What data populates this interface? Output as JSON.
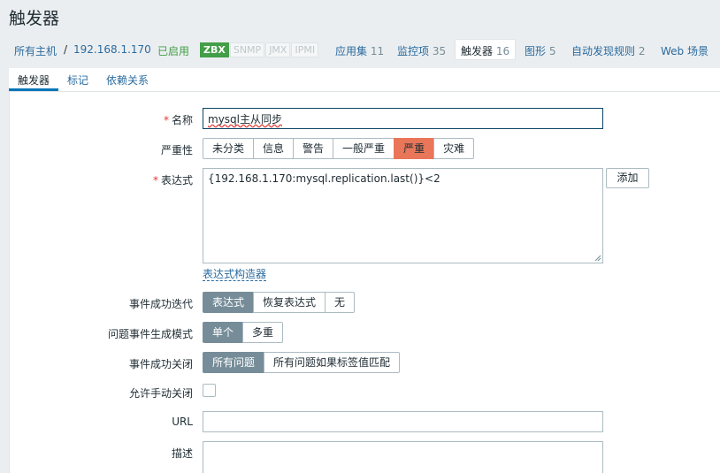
{
  "page": {
    "title": "触发器"
  },
  "host_nav": {
    "all_hosts": "所有主机",
    "separator": "/",
    "host": "192.168.1.170",
    "status": "已启用",
    "interfaces": [
      "ZBX",
      "SNMP",
      "JMX",
      "IPMI"
    ],
    "applications": {
      "label": "应用集",
      "count": "11"
    },
    "items": {
      "label": "监控项",
      "count": "35"
    },
    "triggers": {
      "label": "触发器",
      "count": "16"
    },
    "graphs": {
      "label": "图形",
      "count": "5"
    },
    "discovery": {
      "label": "自动发现规则",
      "count": "2"
    },
    "web": {
      "label": "Web 场景"
    }
  },
  "tabs": [
    "触发器",
    "标记",
    "依赖关系"
  ],
  "form": {
    "name": {
      "label": "名称",
      "value": "mysql主从同步"
    },
    "severity": {
      "label": "严重性",
      "options": [
        "未分类",
        "信息",
        "警告",
        "一般严重",
        "严重",
        "灾难"
      ],
      "selected": "严重"
    },
    "expression": {
      "label": "表达式",
      "value": "{192.168.1.170:mysql.replication.last()}<2",
      "add_button": "添加",
      "builder_link": "表达式构造器"
    },
    "ok_event_generation": {
      "label": "事件成功迭代",
      "options": [
        "表达式",
        "恢复表达式",
        "无"
      ],
      "selected": "表达式"
    },
    "problem_event_mode": {
      "label": "问题事件生成模式",
      "options": [
        "单个",
        "多重"
      ],
      "selected": "单个"
    },
    "ok_event_closes": {
      "label": "事件成功关闭",
      "options": [
        "所有问题",
        "所有问题如果标签值匹配"
      ],
      "selected": "所有问题"
    },
    "manual_close": {
      "label": "允许手动关闭",
      "checked": false
    },
    "url": {
      "label": "URL",
      "value": ""
    },
    "description": {
      "label": "描述",
      "value": ""
    }
  },
  "colors": {
    "accent": "#0275b8",
    "severity_high": "#e97659",
    "enabled": "#429e47",
    "segment_selected": "#768d99"
  }
}
